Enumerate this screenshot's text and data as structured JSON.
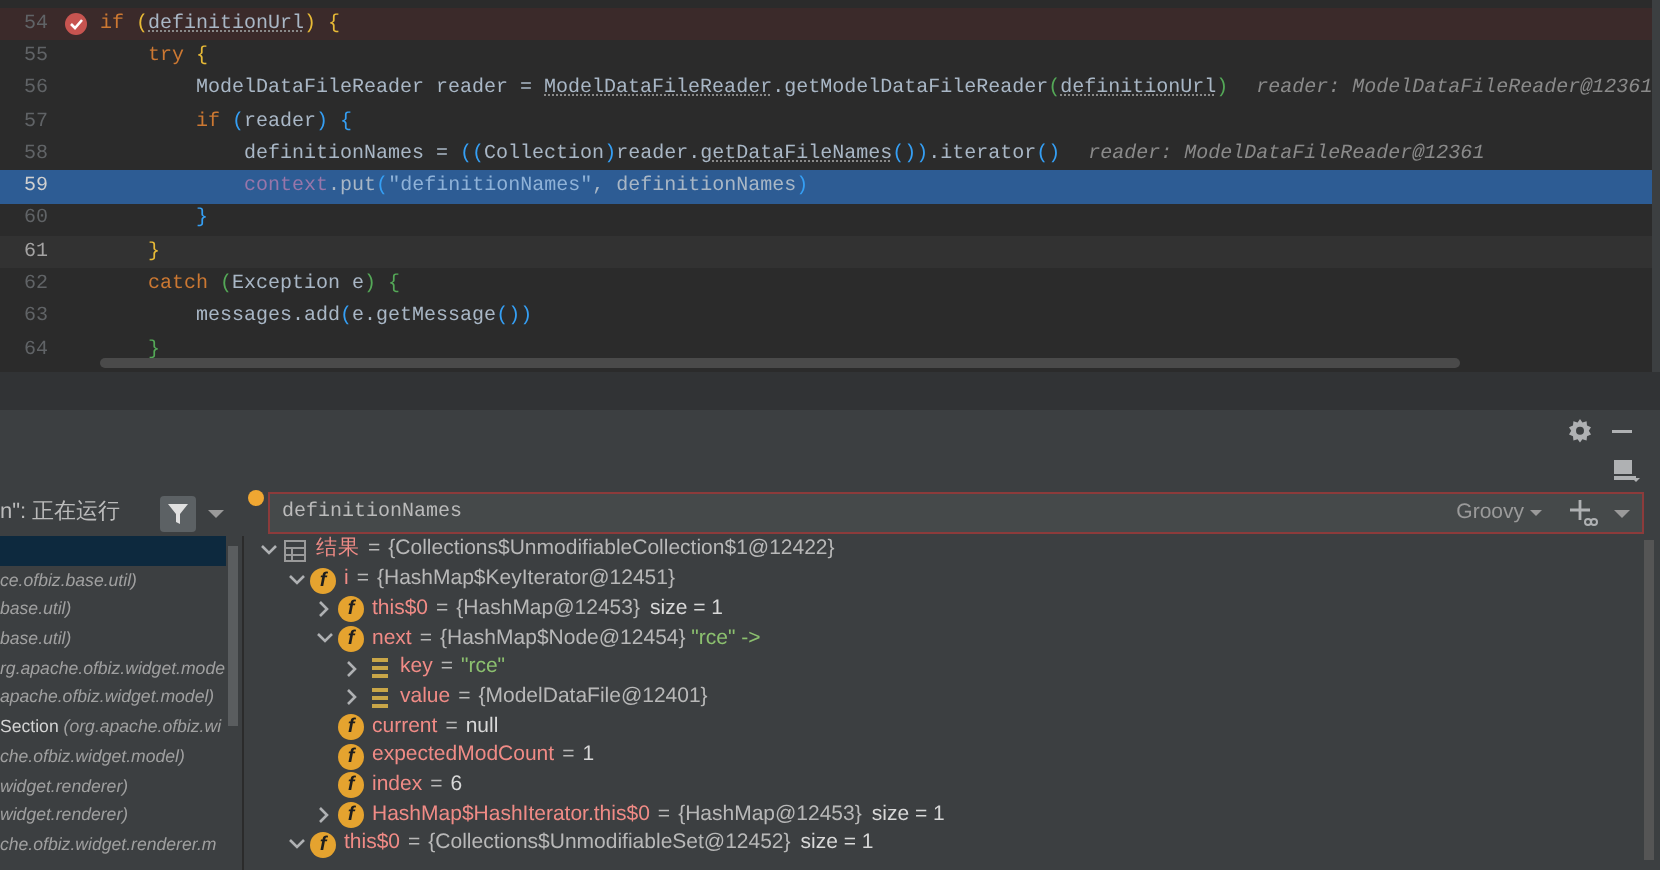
{
  "editor": {
    "lines": [
      {
        "number": "54",
        "breakpoint": true,
        "current": false,
        "caret": false,
        "tokens": [
          {
            "text": "if ",
            "kind": "keyword"
          },
          {
            "text": "(",
            "kind": "paren1"
          },
          {
            "text": "definitionUrl",
            "kind": "underlined"
          },
          {
            "text": ") {",
            "kind": "paren1"
          }
        ]
      },
      {
        "number": "55",
        "breakpoint": false,
        "current": false,
        "caret": false,
        "tokens": [
          {
            "text": "    try ",
            "kind": "keyword"
          },
          {
            "text": "{",
            "kind": "paren1"
          }
        ]
      },
      {
        "number": "56",
        "breakpoint": false,
        "current": false,
        "caret": false,
        "tokens": [
          {
            "text": "        ModelDataFileReader reader = ",
            "kind": "plain"
          },
          {
            "text": "ModelDataFileReader",
            "kind": "underlined"
          },
          {
            "text": ".getModelDataFileReader",
            "kind": "plain"
          },
          {
            "text": "(",
            "kind": "paren2"
          },
          {
            "text": "definitionUrl",
            "kind": "underlined"
          },
          {
            "text": ")",
            "kind": "paren2"
          }
        ],
        "hint": "reader: ModelDataFileReader@12361"
      },
      {
        "number": "57",
        "breakpoint": false,
        "current": false,
        "caret": false,
        "tokens": [
          {
            "text": "        if ",
            "kind": "keyword"
          },
          {
            "text": "(",
            "kind": "paren3"
          },
          {
            "text": "reader",
            "kind": "plain"
          },
          {
            "text": ") {",
            "kind": "paren3"
          }
        ]
      },
      {
        "number": "58",
        "breakpoint": false,
        "current": false,
        "caret": false,
        "tokens": [
          {
            "text": "            definitionNames = ",
            "kind": "plain"
          },
          {
            "text": "((",
            "kind": "paren3"
          },
          {
            "text": "Collection",
            "kind": "plain"
          },
          {
            "text": ")",
            "kind": "paren3"
          },
          {
            "text": "reader.",
            "kind": "plain"
          },
          {
            "text": "getDataFileNames",
            "kind": "underlined"
          },
          {
            "text": "())",
            "kind": "paren3"
          },
          {
            "text": ".iterator",
            "kind": "plain"
          },
          {
            "text": "()",
            "kind": "paren3"
          }
        ],
        "hint": "reader: ModelDataFileReader@12361"
      },
      {
        "number": "59",
        "breakpoint": false,
        "current": true,
        "caret": false,
        "tokens": [
          {
            "text": "            context",
            "kind": "field"
          },
          {
            "text": ".put",
            "kind": "plain"
          },
          {
            "text": "(",
            "kind": "paren3"
          },
          {
            "text": "\"definitionNames\"",
            "kind": "string"
          },
          {
            "text": ", definitionNames",
            "kind": "plain"
          },
          {
            "text": ")",
            "kind": "paren3"
          }
        ]
      },
      {
        "number": "60",
        "breakpoint": false,
        "current": false,
        "caret": false,
        "tokens": [
          {
            "text": "        }",
            "kind": "paren3"
          }
        ]
      },
      {
        "number": "61",
        "breakpoint": false,
        "current": false,
        "caret": true,
        "tokens": [
          {
            "text": "    }",
            "kind": "paren1"
          }
        ]
      },
      {
        "number": "62",
        "breakpoint": false,
        "current": false,
        "caret": false,
        "tokens": [
          {
            "text": "    catch ",
            "kind": "keyword"
          },
          {
            "text": "(",
            "kind": "paren2"
          },
          {
            "text": "Exception e",
            "kind": "plain"
          },
          {
            "text": ") {",
            "kind": "paren2"
          }
        ]
      },
      {
        "number": "63",
        "breakpoint": false,
        "current": false,
        "caret": false,
        "tokens": [
          {
            "text": "        messages.add",
            "kind": "plain"
          },
          {
            "text": "(",
            "kind": "paren3"
          },
          {
            "text": "e.getMessage",
            "kind": "plain"
          },
          {
            "text": "())",
            "kind": "paren3"
          }
        ]
      },
      {
        "number": "64",
        "breakpoint": false,
        "current": false,
        "caret": false,
        "tokens": [
          {
            "text": "    }",
            "kind": "paren2"
          }
        ]
      }
    ]
  },
  "frames_toolbar": {
    "thread": "n\": 正在运行"
  },
  "frames": [
    {
      "selected": true
    },
    {
      "selected": false,
      "location": "ce.ofbiz.base.util)"
    },
    {
      "selected": false,
      "location": "base.util)"
    },
    {
      "selected": false,
      "location": "base.util)"
    },
    {
      "selected": false,
      "location": "rg.apache.ofbiz.widget.mode"
    },
    {
      "selected": false,
      "location": "apache.ofbiz.widget.model)"
    },
    {
      "selected": false,
      "method": "Section",
      "location": "(org.apache.ofbiz.wi"
    },
    {
      "selected": false,
      "location": "che.ofbiz.widget.model)"
    },
    {
      "selected": false,
      "location": "widget.renderer)"
    },
    {
      "selected": false,
      "location": "widget.renderer)"
    },
    {
      "selected": false,
      "location": "che.ofbiz.widget.renderer.m"
    }
  ],
  "evaluate": {
    "expression": "definitionNames",
    "language": "Groovy"
  },
  "variables": [
    {
      "kind": "result",
      "name": "结果",
      "operator": "=",
      "value": "{Collections$UnmodifiableCollection$1@12422}",
      "expanded": true,
      "children": [
        {
          "kind": "field",
          "icon_text": "f",
          "name": "i",
          "operator": "=",
          "value": "{HashMap$KeyIterator@12451}",
          "expanded": true,
          "children": [
            {
              "kind": "field",
              "icon_text": "f",
              "name": "this$0",
              "operator": "=",
              "value": "{HashMap@12453}",
              "extra": "size = 1",
              "expanded": false
            },
            {
              "kind": "field",
              "icon_text": "f",
              "name": "next",
              "operator": "=",
              "value": "{HashMap$Node@12454}",
              "string": "\"rce\" ->",
              "expanded": true,
              "children": [
                {
                  "kind": "entry",
                  "name": "key",
                  "operator": "=",
                  "string": "\"rce\"",
                  "expanded": false
                },
                {
                  "kind": "entry",
                  "name": "value",
                  "operator": "=",
                  "value": "{ModelDataFile@12401}",
                  "expanded": false
                }
              ]
            },
            {
              "kind": "field",
              "icon_text": "f",
              "name": "current",
              "operator": "=",
              "literal": "null"
            },
            {
              "kind": "field",
              "icon_text": "f",
              "name": "expectedModCount",
              "operator": "=",
              "literal": "1"
            },
            {
              "kind": "field",
              "icon_text": "f",
              "name": "index",
              "operator": "=",
              "literal": "6"
            },
            {
              "kind": "field",
              "icon_text": "f",
              "name": "HashMap$HashIterator.this$0",
              "operator": "=",
              "value": "{HashMap@12453}",
              "extra": "size = 1",
              "expanded": false
            }
          ]
        },
        {
          "kind": "field",
          "icon_text": "f",
          "name": "this$0",
          "operator": "=",
          "value": "{Collections$UnmodifiableSet@12452}",
          "extra": "size = 1",
          "expanded": true
        }
      ]
    }
  ]
}
